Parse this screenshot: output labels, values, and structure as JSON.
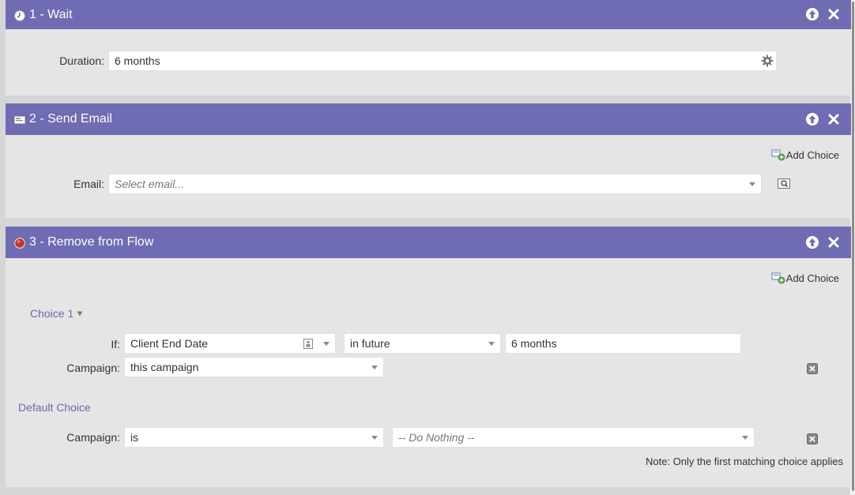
{
  "steps": [
    {
      "title": "1 - Wait",
      "duration_label": "Duration:",
      "duration_value": "6 months"
    },
    {
      "title": "2 - Send Email",
      "add_choice": "Add Choice",
      "email_label": "Email:",
      "email_placeholder": "Select email..."
    },
    {
      "title": "3 - Remove from Flow",
      "add_choice": "Add Choice",
      "choice1_label": "Choice 1",
      "if_label": "If:",
      "if_attribute": "Client End Date",
      "if_operator": "in future",
      "if_value": "6 months",
      "campaign_label": "Campaign:",
      "campaign_value": "this campaign",
      "default_choice_label": "Default Choice",
      "default_campaign_label": "Campaign:",
      "default_campaign_operator": "is",
      "default_campaign_value": "-- Do Nothing --",
      "note": "Note: Only the first matching choice applies"
    }
  ],
  "colors": {
    "header_bg": "#6f6cb3",
    "panel_bg": "#e5e5e5",
    "link": "#6a69a8"
  }
}
